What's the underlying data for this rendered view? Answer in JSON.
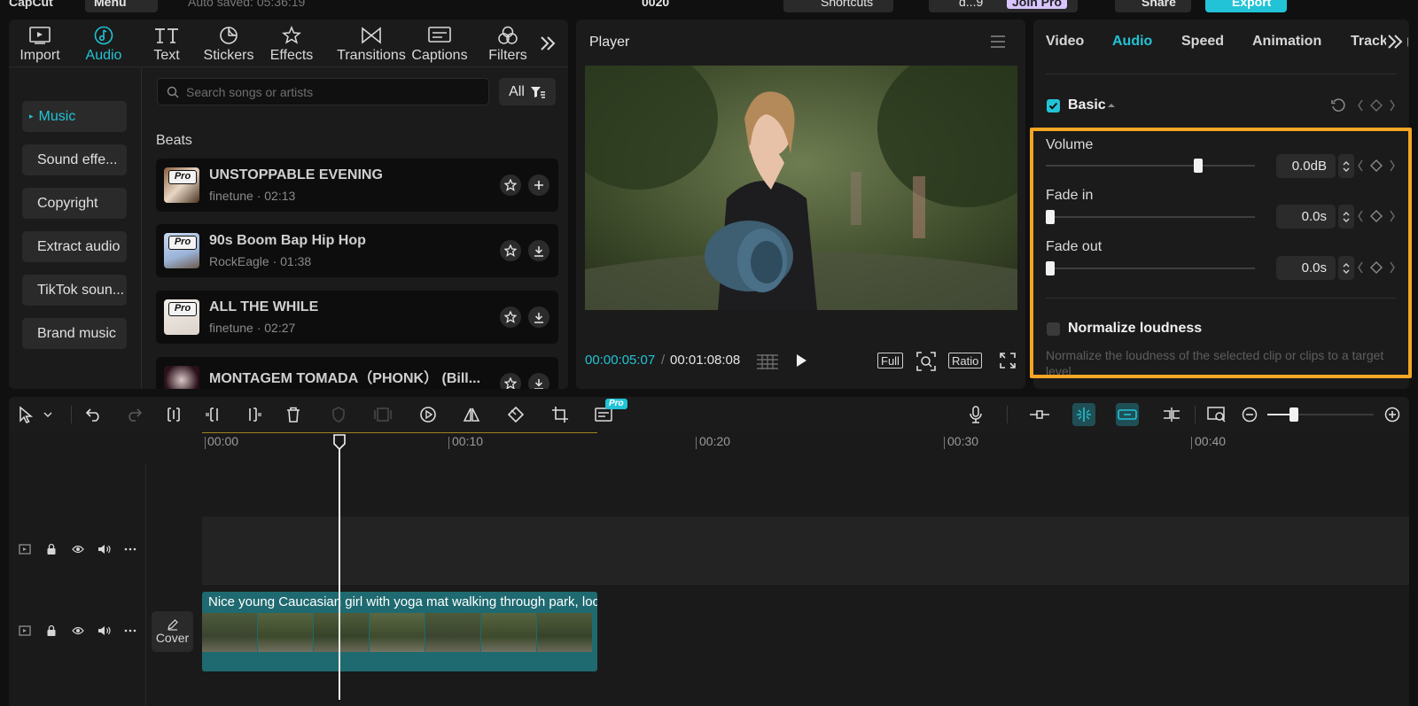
{
  "topbar": {
    "logo_text": "CapCut",
    "menu_label": "Menu",
    "autosave_text": "Auto saved: 05:36:19",
    "project_name": "0020",
    "shortcuts_label": "Shortcuts",
    "user_label": "d...9",
    "join_pro_label": "Join Pro",
    "share_label": "Share",
    "export_label": "Export"
  },
  "media_tools": [
    {
      "label": "Import",
      "icon": "import-icon"
    },
    {
      "label": "Audio",
      "icon": "audio-icon",
      "active": true
    },
    {
      "label": "Text",
      "icon": "text-icon"
    },
    {
      "label": "Stickers",
      "icon": "stickers-icon"
    },
    {
      "label": "Effects",
      "icon": "effects-icon"
    },
    {
      "label": "Transitions",
      "icon": "transitions-icon"
    },
    {
      "label": "Captions",
      "icon": "captions-icon"
    },
    {
      "label": "Filters",
      "icon": "filters-icon"
    }
  ],
  "audio_sidebar": [
    "Music",
    "Sound effe...",
    "Copyright",
    "Extract audio",
    "TikTok soun...",
    "Brand music"
  ],
  "search": {
    "placeholder": "Search songs or artists",
    "filter_label": "All"
  },
  "section_label": "Beats",
  "songs": [
    {
      "title": "UNSTOPPABLE EVENING",
      "meta": "finetune · 02:13",
      "action": "add",
      "badge": "Pro"
    },
    {
      "title": "90s Boom Bap Hip Hop",
      "meta": "RockEagle · 01:38",
      "action": "download",
      "badge": "Pro"
    },
    {
      "title": "ALL THE WHILE",
      "meta": "finetune · 02:27",
      "action": "download",
      "badge": "Pro"
    },
    {
      "title": "MONTAGEM TOMADA（PHONK） (Bill...",
      "meta": "",
      "action": "download",
      "badge": ""
    }
  ],
  "player": {
    "title": "Player",
    "current_time": "00:00:05:07",
    "separator": "/",
    "duration": "00:01:08:08",
    "full_label": "Full",
    "ratio_label": "Ratio"
  },
  "inspector": {
    "tabs": [
      "Video",
      "Audio",
      "Speed",
      "Animation",
      "Tracking"
    ],
    "active_tab": "Audio",
    "basic_label": "Basic",
    "volume_label": "Volume",
    "volume_value": "0.0dB",
    "volume_level": 0.74,
    "fadein_label": "Fade in",
    "fadein_value": "0.0s",
    "fadein_level": 0.0,
    "fadeout_label": "Fade out",
    "fadeout_value": "0.0s",
    "fadeout_level": 0.0,
    "normalize_label": "Normalize loudness",
    "normalize_desc": "Normalize the loudness of the selected clip or clips to a target level",
    "highlight_color": "#f5a623",
    "accent_color": "#22c3d6"
  },
  "timeline": {
    "ruler": [
      "00:00",
      "00:10",
      "00:20",
      "00:30",
      "00:40"
    ],
    "clip_title": "Nice young Caucasian girl with yoga mat walking through park, loo",
    "cover_label": "Cover",
    "pro_badge": "Pro",
    "zoom_level": 0.25
  }
}
